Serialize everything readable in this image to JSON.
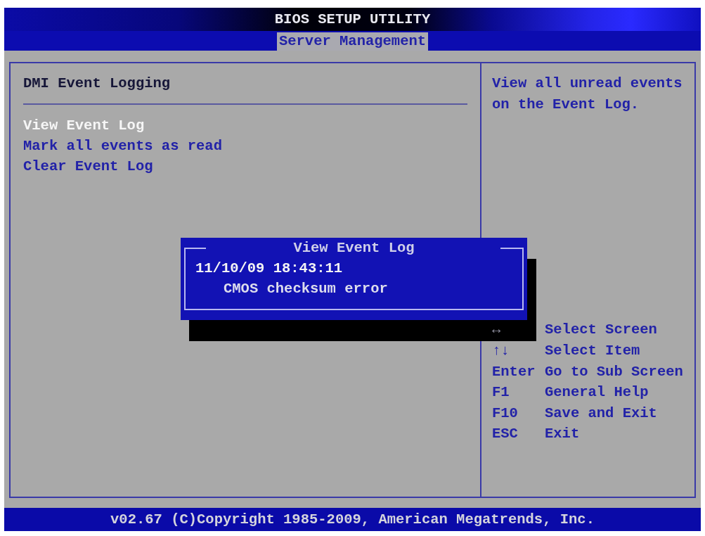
{
  "window": {
    "title": "BIOS SETUP UTILITY"
  },
  "tabs": [
    {
      "label": "Server Management",
      "selected": true
    }
  ],
  "section": {
    "title": "DMI Event Logging",
    "items": [
      {
        "label": "View Event Log",
        "selected": true
      },
      {
        "label": "Mark all events as read",
        "selected": false
      },
      {
        "label": "Clear Event Log",
        "selected": false
      }
    ]
  },
  "help": {
    "text": "View all unread events on the Event Log."
  },
  "keys": [
    {
      "key": "↔",
      "action": "Select Screen",
      "shaded": true
    },
    {
      "key": "↑↓",
      "action": "Select Item",
      "shaded": false
    },
    {
      "key": "Enter",
      "action": "Go to Sub Screen",
      "shaded": false
    },
    {
      "key": "F1",
      "action": "General Help",
      "shaded": false
    },
    {
      "key": "F10",
      "action": "Save and Exit",
      "shaded": false
    },
    {
      "key": "ESC",
      "action": "Exit",
      "shaded": false
    }
  ],
  "dialog": {
    "title": "View Event Log",
    "lines": [
      {
        "kind": "timestamp",
        "text": "11/10/09 18:43:11"
      },
      {
        "kind": "message",
        "text": "CMOS checksum error"
      }
    ]
  },
  "status_bar": {
    "text": "v02.67 (C)Copyright 1985-2009, American Megatrends, Inc."
  }
}
